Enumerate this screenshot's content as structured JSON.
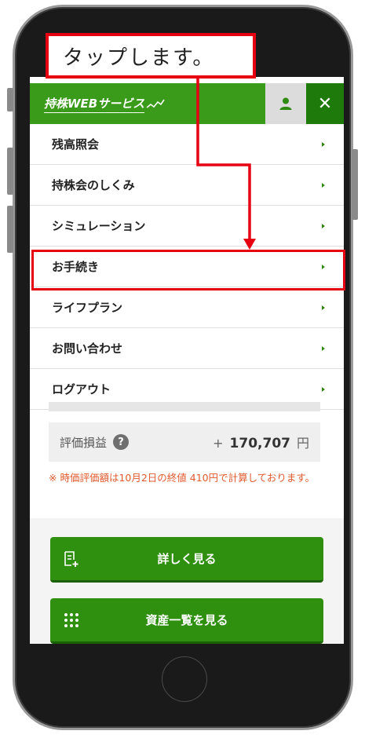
{
  "annotation": {
    "callout_text": "タップします。"
  },
  "header": {
    "brand": "持株WEBサービス",
    "user_icon": "user-icon",
    "close_label": "✕"
  },
  "menu": {
    "items": [
      {
        "label": "残高照会"
      },
      {
        "label": "持株会のしくみ"
      },
      {
        "label": "シミュレーション"
      },
      {
        "label": "お手続き"
      },
      {
        "label": "ライフプラン"
      },
      {
        "label": "お問い合わせ"
      },
      {
        "label": "ログアウト"
      }
    ]
  },
  "summary": {
    "gain_label": "評価損益",
    "help_label": "?",
    "gain_sign": "+",
    "gain_value": "170,707",
    "gain_unit": "円",
    "note": "※ 時価評価額は10月2日の終値 410円で計算しております。"
  },
  "actions": {
    "detail_label": "詳しく見る",
    "assets_label": "資産一覧を見る"
  },
  "colors": {
    "primary": "#3a9a1a",
    "primary_dark": "#1f7a0c",
    "annotation": "#e60012",
    "note": "#e05a2e"
  }
}
